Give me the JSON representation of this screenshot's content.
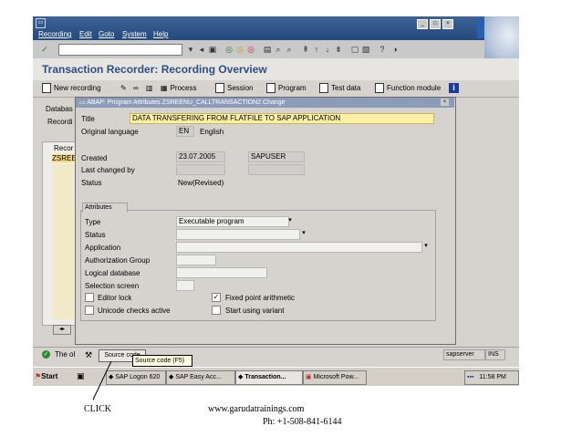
{
  "menubar": {
    "items": [
      "Recording",
      "Edit",
      "Goto",
      "System",
      "Help"
    ],
    "logo": "SAP"
  },
  "page": {
    "title": "Transaction Recorder: Recording Overview"
  },
  "app_toolbar": {
    "new_recording": "New recording",
    "process": "Process",
    "session": "Session",
    "program": "Program",
    "test_data": "Test data",
    "function_module": "Function module"
  },
  "background": {
    "database_label": "Databas",
    "recording_label": "Recordi",
    "column_header": "Recor",
    "first_row": "ZSREEI",
    "status_text": "The ol",
    "status_right_server": "sapserver",
    "status_right_mode": "INS"
  },
  "dialog": {
    "title": "ABAP: Program Attributes ZSREENU_CALLTRANSACTION2 Change",
    "title_label": "Title",
    "title_value": "DATA TRANSFERING FROM FLATFILE TO SAP APPLICATION",
    "orig_lang_label": "Original language",
    "orig_lang_code": "EN",
    "orig_lang_name": "English",
    "created_label": "Created",
    "created_date": "23.07.2005",
    "created_user": "SAPUSER",
    "last_changed_label": "Last changed by",
    "status_label": "Status",
    "status_value": "New(Revised)",
    "attributes_group": "Attributes",
    "type_label": "Type",
    "type_value": "Executable program",
    "attr_status_label": "Status",
    "application_label": "Application",
    "auth_group_label": "Authorization Group",
    "logical_db_label": "Logical database",
    "selection_screen_label": "Selection screen",
    "editor_lock_label": "Editor lock",
    "fixed_point_label": "Fixed point arithmetic",
    "unicode_label": "Unicode checks active",
    "start_variant_label": "Start using variant",
    "fixed_point_checked": true
  },
  "source_button": {
    "label": "Source code",
    "tooltip": "Source code  (F5)"
  },
  "taskbar": {
    "start": "Start",
    "tasks": [
      "SAP Logon 620",
      "SAP Easy Acc...",
      "Transaction...",
      "Microsoft Pow..."
    ],
    "clock": "11:58 PM"
  },
  "annotations": {
    "click": "CLICK",
    "website": "www.garudatrainings.com",
    "phone": "Ph: +1-508-841-6144"
  },
  "colors": {
    "title_blue": "#2d4f82",
    "menubar_blue": "#244a7d",
    "highlight_yellow": "#fdf0a6",
    "sap_blue": "#2860b0"
  }
}
